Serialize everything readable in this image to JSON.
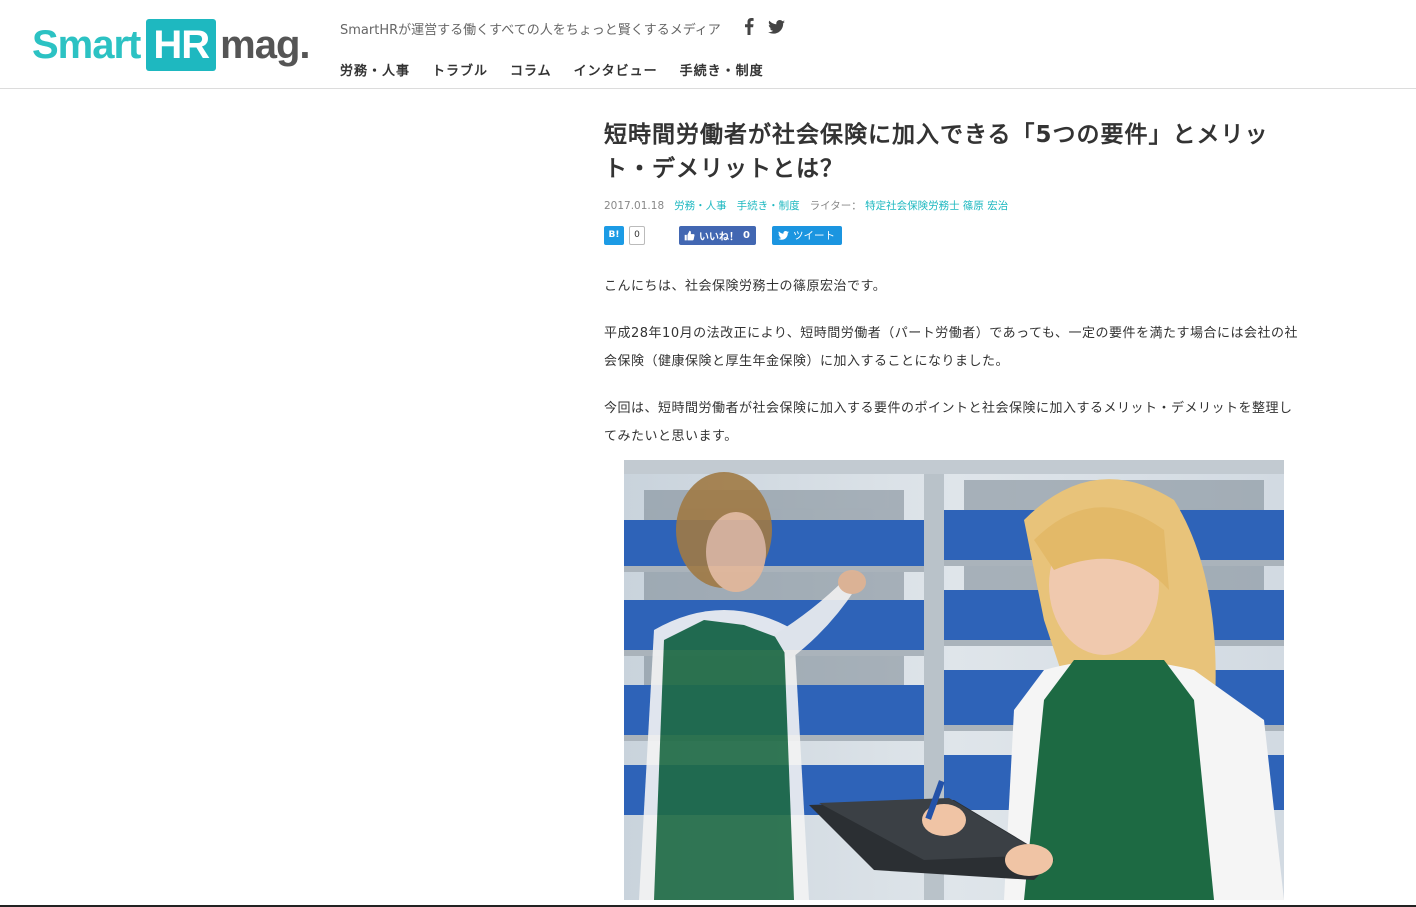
{
  "header": {
    "logo": {
      "smart": "Smart",
      "hr": "HR",
      "mag": "mag."
    },
    "tagline": "SmartHRが運営する働くすべての人をちょっと賢くするメディア",
    "social": [
      {
        "icon": "facebook-icon"
      },
      {
        "icon": "twitter-icon"
      }
    ],
    "nav": [
      {
        "label": "労務・人事"
      },
      {
        "label": "トラブル"
      },
      {
        "label": "コラム"
      },
      {
        "label": "インタビュー"
      },
      {
        "label": "手続き・制度"
      }
    ]
  },
  "article": {
    "title": "短時間労働者が社会保険に加入できる「5つの要件」とメリット・デメリットとは？",
    "date": "2017.01.18",
    "categories": [
      "労務・人事",
      "手続き・制度"
    ],
    "writer_label": "ライター：",
    "writer_name": "特定社会保険労務士 篠原 宏治",
    "share": {
      "hatena_label": "B!",
      "hatena_count": "0",
      "fb_like_label": "いいね！",
      "fb_like_count": "0",
      "tweet_label": "ツイート"
    },
    "paragraphs": [
      "こんにちは、社会保険労務士の篠原宏治です。",
      "平成28年10月の法改正により、短時間労働者（パート労働者）であっても、一定の要件を満たす場合には会社の社会保険（健康保険と厚生年金保険）に加入することになりました。",
      "今回は、短時間労働者が社会保険に加入する要件のポイントと社会保険に加入するメリット・デメリットを整理してみたいと思います。"
    ]
  },
  "colors": {
    "brand": "#1eb8c0",
    "facebook": "#4267b2",
    "twitter": "#1b95e0",
    "hatena": "#1c9be5"
  }
}
